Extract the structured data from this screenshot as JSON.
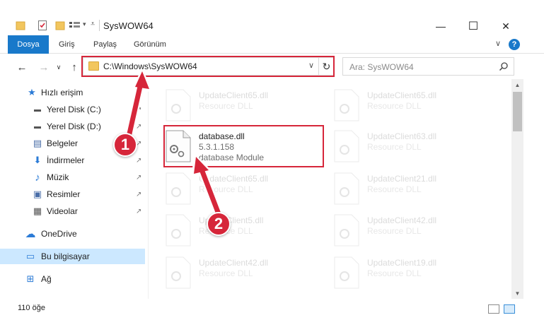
{
  "window": {
    "title": "SysWOW64",
    "minimize_glyph": "—",
    "maximize_glyph": "☐",
    "close_glyph": "✕"
  },
  "ribbon": {
    "file_tab": "Dosya",
    "tabs": [
      "Giriş",
      "Paylaş",
      "Görünüm"
    ],
    "expand_glyph": "∨",
    "help_glyph": "?"
  },
  "navigation": {
    "back_glyph": "←",
    "forward_glyph": "→",
    "recent_glyph": "∨",
    "up_glyph": "↑",
    "address": "C:\\Windows\\SysWOW64",
    "address_dropdown_glyph": "∨",
    "refresh_glyph": "↻",
    "search_placeholder": "Ara: SysWOW64"
  },
  "sidebar": {
    "items": [
      {
        "label": "Hızlı erişim",
        "icon": "star-icon",
        "glyph": "★",
        "pinned": false
      },
      {
        "label": "Yerel Disk (C:)",
        "icon": "disk-icon",
        "glyph": "▬",
        "pinned": true
      },
      {
        "label": "Yerel Disk (D:)",
        "icon": "disk-icon",
        "glyph": "▬",
        "pinned": true
      },
      {
        "label": "Belgeler",
        "icon": "documents-icon",
        "glyph": "▤",
        "pinned": true
      },
      {
        "label": "İndirmeler",
        "icon": "downloads-icon",
        "glyph": "⬇",
        "pinned": true
      },
      {
        "label": "Müzik",
        "icon": "music-icon",
        "glyph": "♪",
        "pinned": true
      },
      {
        "label": "Resimler",
        "icon": "pictures-icon",
        "glyph": "▣",
        "pinned": true
      },
      {
        "label": "Videolar",
        "icon": "videos-icon",
        "glyph": "▦",
        "pinned": true
      },
      {
        "label": "OneDrive",
        "icon": "cloud-icon",
        "glyph": "☁",
        "pinned": false
      },
      {
        "label": "Bu bilgisayar",
        "icon": "computer-icon",
        "glyph": "▭",
        "pinned": false,
        "selected": true
      },
      {
        "label": "Ağ",
        "icon": "network-icon",
        "glyph": "⊞",
        "pinned": false
      }
    ],
    "pin_glyph": "📌"
  },
  "files": {
    "left_column": [
      {
        "name": "UpdateClient65.dll",
        "line2": "Resource DLL",
        "line3": "",
        "faded": true
      },
      {
        "name": "database.dll",
        "line2": "5.3.1.158",
        "line3": "database Module",
        "faded": false
      },
      {
        "name": "UpdateClient65.dll",
        "line2": "Resource DLL",
        "line3": "",
        "faded": true
      },
      {
        "name": "UpdateClient5.dll",
        "line2": "Resource DLL",
        "line3": "",
        "faded": true
      },
      {
        "name": "UpdateClient42.dll",
        "line2": "Resource DLL",
        "line3": "",
        "faded": true
      }
    ],
    "right_column": [
      {
        "name": "UpdateClient65.dll",
        "line2": "Resource DLL",
        "line3": "",
        "faded": true
      },
      {
        "name": "UpdateClient63.dll",
        "line2": "Resource DLL",
        "line3": "",
        "faded": true
      },
      {
        "name": "UpdateClient21.dll",
        "line2": "Resource DLL",
        "line3": "",
        "faded": true
      },
      {
        "name": "UpdateClient42.dll",
        "line2": "Resource DLL",
        "line3": "",
        "faded": true
      },
      {
        "name": "UpdateClient19.dll",
        "line2": "Resource DLL",
        "line3": "",
        "faded": true
      }
    ]
  },
  "status": {
    "item_count": "110 öğe"
  },
  "annotations": {
    "step1": "1",
    "step2": "2",
    "color": "#d6263a"
  },
  "colors": {
    "accent": "#1979ca",
    "selected_bg": "#cce8ff",
    "highlight": "#d6263a"
  }
}
